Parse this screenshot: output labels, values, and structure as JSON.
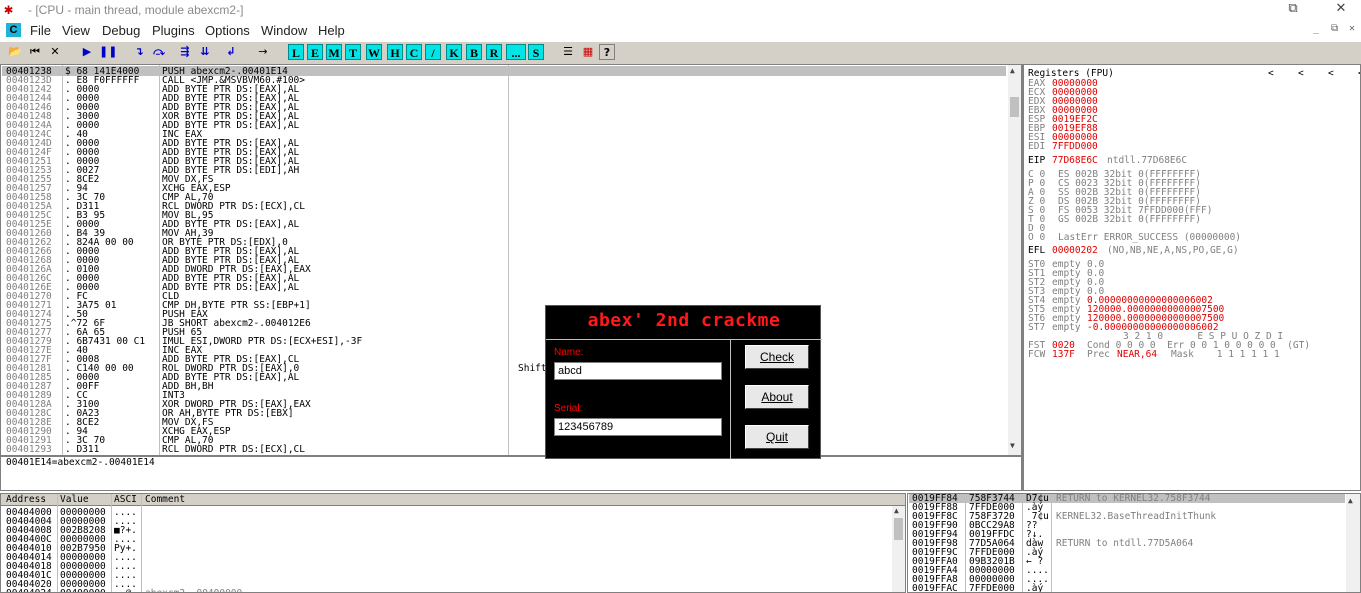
{
  "window": {
    "title": "- [CPU - main thread, module abexcm2-]",
    "restore_glyph": "⧉",
    "close_glyph": "✕"
  },
  "menu": {
    "app_icon": "C",
    "items": [
      "File",
      "View",
      "Debug",
      "Plugins",
      "Options",
      "Window",
      "Help"
    ],
    "right_controls": [
      "_",
      "⧉",
      "✕"
    ]
  },
  "toolbar": {
    "buttons": [
      {
        "name": "open-icon",
        "glyph": "📂"
      },
      {
        "name": "restart-icon",
        "glyph": "⏮"
      },
      {
        "name": "close-file-icon",
        "glyph": "✕"
      },
      {
        "name": "run-icon",
        "glyph": "▶"
      },
      {
        "name": "pause-icon",
        "glyph": "❚❚"
      },
      {
        "name": "step-into-icon",
        "glyph": "↴"
      },
      {
        "name": "step-over-icon",
        "glyph": "⤼"
      },
      {
        "name": "trace-into-icon",
        "glyph": "⇶"
      },
      {
        "name": "trace-over-icon",
        "glyph": "⇊"
      },
      {
        "name": "execute-till-return-icon",
        "glyph": "↲"
      },
      {
        "name": "goto-icon",
        "glyph": "→"
      }
    ],
    "letters": [
      "L",
      "E",
      "M",
      "T",
      "W",
      "H",
      "C",
      "/",
      "K",
      "B",
      "R",
      "...",
      "S"
    ],
    "extra": [
      {
        "name": "list-icon",
        "glyph": "☰"
      },
      {
        "name": "grid-icon",
        "glyph": "▦"
      },
      {
        "name": "help-icon",
        "glyph": "?"
      }
    ]
  },
  "cpu": {
    "rows": [
      {
        "addr": "00401238",
        "hex": "$ 68 141E4000",
        "dis": "PUSH abexcm2-.00401E14"
      },
      {
        "addr": "0040123D",
        "hex": ". E8 F0FFFFFF",
        "dis": "CALL <JMP.&MSVBVM60.#100>"
      },
      {
        "addr": "00401242",
        "hex": ". 0000",
        "dis": "ADD BYTE PTR DS:[EAX],AL"
      },
      {
        "addr": "00401244",
        "hex": ". 0000",
        "dis": "ADD BYTE PTR DS:[EAX],AL"
      },
      {
        "addr": "00401246",
        "hex": ". 0000",
        "dis": "ADD BYTE PTR DS:[EAX],AL"
      },
      {
        "addr": "00401248",
        "hex": ". 3000",
        "dis": "XOR BYTE PTR DS:[EAX],AL"
      },
      {
        "addr": "0040124A",
        "hex": ". 0000",
        "dis": "ADD BYTE PTR DS:[EAX],AL"
      },
      {
        "addr": "0040124C",
        "hex": ". 40",
        "dis": "INC EAX"
      },
      {
        "addr": "0040124D",
        "hex": ". 0000",
        "dis": "ADD BYTE PTR DS:[EAX],AL"
      },
      {
        "addr": "0040124F",
        "hex": ". 0000",
        "dis": "ADD BYTE PTR DS:[EAX],AL"
      },
      {
        "addr": "00401251",
        "hex": ". 0000",
        "dis": "ADD BYTE PTR DS:[EAX],AL"
      },
      {
        "addr": "00401253",
        "hex": ". 0027",
        "dis": "ADD BYTE PTR DS:[EDI],AH"
      },
      {
        "addr": "00401255",
        "hex": ". 8CE2",
        "dis": "MOV DX,FS"
      },
      {
        "addr": "00401257",
        "hex": ". 94",
        "dis": "XCHG EAX,ESP"
      },
      {
        "addr": "00401258",
        "hex": ". 3C 70",
        "dis": "CMP AL,70"
      },
      {
        "addr": "0040125A",
        "hex": ". D311",
        "dis": "RCL DWORD PTR DS:[ECX],CL"
      },
      {
        "addr": "0040125C",
        "hex": ". B3 95",
        "dis": "MOV BL,95"
      },
      {
        "addr": "0040125E",
        "hex": ". 0000",
        "dis": "ADD BYTE PTR DS:[EAX],AL"
      },
      {
        "addr": "00401260",
        "hex": ". B4 39",
        "dis": "MOV AH,39"
      },
      {
        "addr": "00401262",
        "hex": ". 824A 00 00",
        "dis": "OR BYTE PTR DS:[EDX],0"
      },
      {
        "addr": "00401266",
        "hex": ". 0000",
        "dis": "ADD BYTE PTR DS:[EAX],AL"
      },
      {
        "addr": "00401268",
        "hex": ". 0000",
        "dis": "ADD BYTE PTR DS:[EAX],AL"
      },
      {
        "addr": "0040126A",
        "hex": ". 0100",
        "dis": "ADD DWORD PTR DS:[EAX],EAX"
      },
      {
        "addr": "0040126C",
        "hex": ". 0000",
        "dis": "ADD BYTE PTR DS:[EAX],AL"
      },
      {
        "addr": "0040126E",
        "hex": ". 0000",
        "dis": "ADD BYTE PTR DS:[EAX],AL"
      },
      {
        "addr": "00401270",
        "hex": ". FC",
        "dis": "CLD"
      },
      {
        "addr": "00401271",
        "hex": ". 3A75 01",
        "dis": "CMP DH,BYTE PTR SS:[EBP+1]"
      },
      {
        "addr": "00401274",
        "hex": ". 50",
        "dis": "PUSH EAX"
      },
      {
        "addr": "00401275",
        "hex": ".^72 6F",
        "dis": "JB SHORT abexcm2-.004012E6"
      },
      {
        "addr": "00401277",
        "hex": ". 6A 65",
        "dis": "PUSH 65"
      },
      {
        "addr": "00401279",
        "hex": ". 6B7431 00 C1",
        "dis": "IMUL ESI,DWORD PTR DS:[ECX+ESI],-3F"
      },
      {
        "addr": "0040127E",
        "hex": ". 40",
        "dis": "INC EAX"
      },
      {
        "addr": "0040127F",
        "hex": ". 0008",
        "dis": "ADD BYTE PTR DS:[EAX],CL"
      },
      {
        "addr": "00401281",
        "hex": ". C140 00 00",
        "dis": "ROL DWORD PTR DS:[EAX],0"
      },
      {
        "addr": "00401285",
        "hex": ". 0000",
        "dis": "ADD BYTE PTR DS:[EAX],AL"
      },
      {
        "addr": "00401287",
        "hex": ". 00FF",
        "dis": "ADD BH,BH"
      },
      {
        "addr": "00401289",
        "hex": ". CC",
        "dis": "INT3"
      },
      {
        "addr": "0040128A",
        "hex": ". 3100",
        "dis": "XOR DWORD PTR DS:[EAX],EAX"
      },
      {
        "addr": "0040128C",
        "hex": ". 0A23",
        "dis": "OR AH,BYTE PTR DS:[EBX]"
      },
      {
        "addr": "0040128E",
        "hex": ". 8CE2",
        "dis": "MOV DX,FS"
      },
      {
        "addr": "00401290",
        "hex": ". 94",
        "dis": "XCHG EAX,ESP"
      },
      {
        "addr": "00401291",
        "hex": ". 3C 70",
        "dis": "CMP AL,70"
      },
      {
        "addr": "00401293",
        "hex": ". D311",
        "dis": "RCL DWORD PTR DS:[ECX],CL"
      }
    ],
    "comment_fragment": "Shift",
    "info_line": "00401E14=abexcm2-.00401E14"
  },
  "registers": {
    "header": "Registers (FPU)",
    "nav": [
      "<",
      "<",
      "<",
      "<"
    ],
    "gp": [
      {
        "name": "EAX",
        "value": "00000000",
        "extra": ""
      },
      {
        "name": "ECX",
        "value": "00000000",
        "extra": ""
      },
      {
        "name": "EDX",
        "value": "00000000",
        "extra": ""
      },
      {
        "name": "EBX",
        "value": "00000000",
        "extra": ""
      },
      {
        "name": "ESP",
        "value": "0019EF2C",
        "extra": ""
      },
      {
        "name": "EBP",
        "value": "0019EF88",
        "extra": ""
      },
      {
        "name": "ESI",
        "value": "00000000",
        "extra": ""
      },
      {
        "name": "EDI",
        "value": "7FFDD000",
        "extra": ""
      }
    ],
    "eip": {
      "name": "EIP",
      "value": "77D68E6C",
      "extra": "ntdll.77D68E6C"
    },
    "flags": [
      {
        "flag": "C 0",
        "seg": "ES 002B 32bit 0(FFFFFFFF)"
      },
      {
        "flag": "P 0",
        "seg": "CS 0023 32bit 0(FFFFFFFF)"
      },
      {
        "flag": "A 0",
        "seg": "SS 002B 32bit 0(FFFFFFFF)"
      },
      {
        "flag": "Z 0",
        "seg": "DS 002B 32bit 0(FFFFFFFF)"
      },
      {
        "flag": "S 0",
        "seg": "FS 0053 32bit 7FFDD000(FFF)"
      },
      {
        "flag": "T 0",
        "seg": "GS 002B 32bit 0(FFFFFFFF)"
      },
      {
        "flag": "D 0",
        "seg": ""
      },
      {
        "flag": "O 0",
        "seg": "LastErr ERROR_SUCCESS (00000000)"
      }
    ],
    "efl": {
      "name": "EFL",
      "value": "00000202",
      "extra": "(NO,NB,NE,A,NS,PO,GE,G)"
    },
    "fpu": [
      {
        "name": "ST0",
        "state": "empty",
        "value": "0.0"
      },
      {
        "name": "ST1",
        "state": "empty",
        "value": "0.0"
      },
      {
        "name": "ST2",
        "state": "empty",
        "value": "0.0"
      },
      {
        "name": "ST3",
        "state": "empty",
        "value": "0.0"
      },
      {
        "name": "ST4",
        "state": "empty",
        "value": "0.00000000000000006002"
      },
      {
        "name": "ST5",
        "state": "empty",
        "value": "120000.00000000000007500"
      },
      {
        "name": "ST6",
        "state": "empty",
        "value": "120000.00000000000007500"
      },
      {
        "name": "ST7",
        "state": "empty",
        "value": "-0.00000000000000006002"
      }
    ],
    "fst_header": "3 2 1 0      E S P U O Z D I",
    "fst": {
      "name": "FST",
      "value": "0020",
      "text": "Cond 0 0 0 0  Err 0 0 1 0 0 0 0 0  (GT)"
    },
    "fcw": {
      "name": "FCW",
      "value": "137F",
      "text": "Prec",
      "prec": "NEAR,64",
      "mask": "Mask    1 1 1 1 1 1"
    }
  },
  "dump": {
    "headers": [
      "Address",
      "Value",
      "ASCI",
      "Comment"
    ],
    "rows": [
      {
        "addr": "00404000",
        "value": "00000000",
        "ascii": "....",
        "comment": ""
      },
      {
        "addr": "00404004",
        "value": "00000000",
        "ascii": "....",
        "comment": ""
      },
      {
        "addr": "00404008",
        "value": "002B8208",
        "ascii": "■?+.",
        "comment": ""
      },
      {
        "addr": "0040400C",
        "value": "00000000",
        "ascii": "....",
        "comment": ""
      },
      {
        "addr": "00404010",
        "value": "002B7950",
        "ascii": "Py+.",
        "comment": ""
      },
      {
        "addr": "00404014",
        "value": "00000000",
        "ascii": "....",
        "comment": ""
      },
      {
        "addr": "00404018",
        "value": "00000000",
        "ascii": "....",
        "comment": ""
      },
      {
        "addr": "0040401C",
        "value": "00000000",
        "ascii": "....",
        "comment": ""
      },
      {
        "addr": "00404020",
        "value": "00000000",
        "ascii": "....",
        "comment": ""
      },
      {
        "addr": "00404024",
        "value": "00400000",
        "ascii": "..@.",
        "comment": "abexcm2-.00400000"
      }
    ]
  },
  "stack": {
    "rows": [
      {
        "addr": "0019FF84",
        "value": "758F3744",
        "ascii": "D7¢u",
        "comment": "RETURN to KERNEL32.758F3744"
      },
      {
        "addr": "0019FF88",
        "value": "7FFDE000",
        "ascii": ".àý",
        "comment": ""
      },
      {
        "addr": "0019FF8C",
        "value": "758F3720",
        "ascii": " 7¢u",
        "comment": "KERNEL32.BaseThreadInitThunk"
      },
      {
        "addr": "0019FF90",
        "value": "0BCC29A8",
        "ascii": "??",
        "comment": ""
      },
      {
        "addr": "0019FF94",
        "value": "0019FFDC",
        "ascii": "?↓.",
        "comment": ""
      },
      {
        "addr": "0019FF98",
        "value": "77D5A064",
        "ascii": "dàw",
        "comment": "RETURN to ntdll.77D5A064"
      },
      {
        "addr": "0019FF9C",
        "value": "7FFDE000",
        "ascii": ".àý",
        "comment": ""
      },
      {
        "addr": "0019FFA0",
        "value": "09B3201B",
        "ascii": "← ?",
        "comment": ""
      },
      {
        "addr": "0019FFA4",
        "value": "00000000",
        "ascii": "....",
        "comment": ""
      },
      {
        "addr": "0019FFA8",
        "value": "00000000",
        "ascii": "....",
        "comment": ""
      },
      {
        "addr": "0019FFAC",
        "value": "7FFDE000",
        "ascii": ".àý",
        "comment": ""
      }
    ]
  },
  "crackme": {
    "title": "abex' 2nd crackme",
    "name_label": "Name:",
    "name_value": "abcd",
    "serial_label": "Serial:",
    "serial_value": "123456789",
    "check_label": "Check",
    "about_label": "About",
    "quit_label": "Quit"
  }
}
